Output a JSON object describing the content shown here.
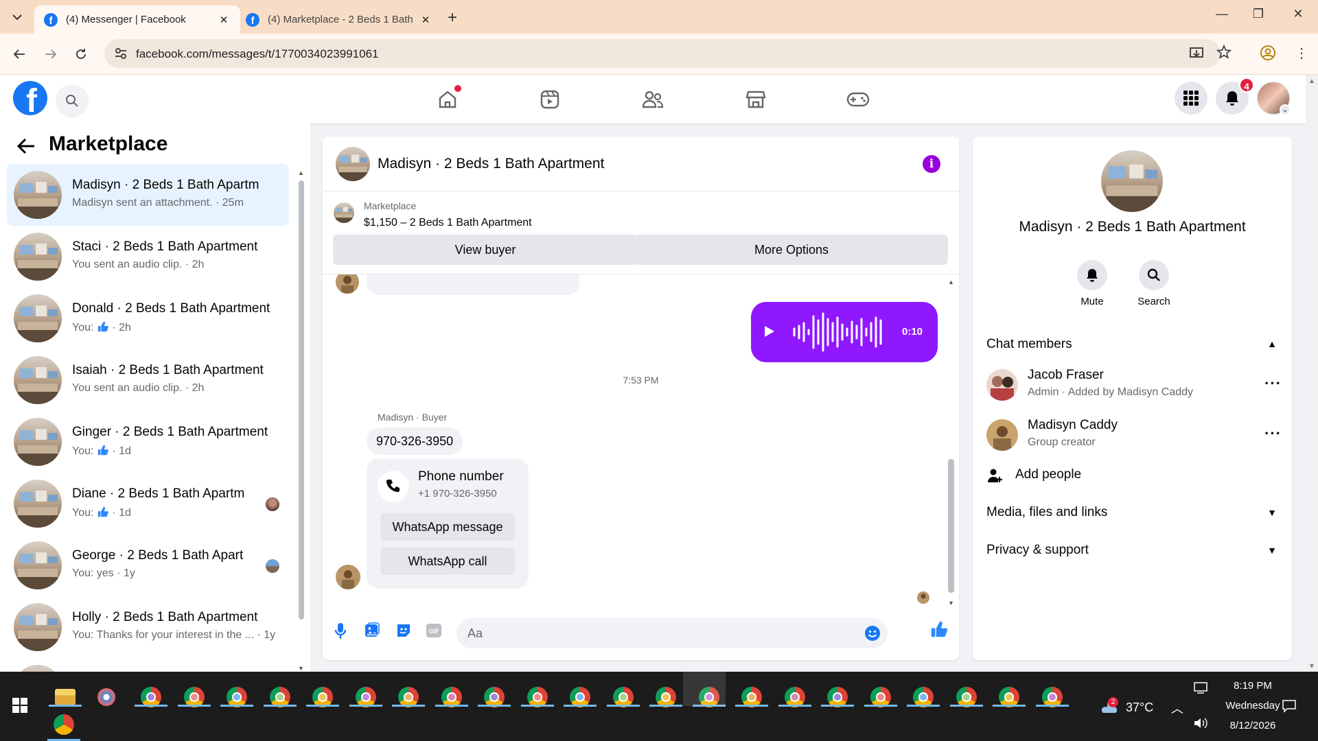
{
  "browser": {
    "tabs": [
      {
        "title": "(4) Messenger | Facebook",
        "active": true
      },
      {
        "title": "(4) Marketplace - 2 Beds 1 Bath",
        "active": false
      }
    ],
    "url": "facebook.com/messages/t/1770034023991061"
  },
  "facebook": {
    "notifications_badge": "4",
    "nav_icons": [
      "home-icon",
      "reels-icon",
      "friends-icon",
      "marketplace-icon",
      "gaming-icon"
    ]
  },
  "sidebar": {
    "title": "Marketplace",
    "conversations": [
      {
        "name": "Madisyn · 2 Beds 1 Bath Apartm",
        "preview": "Madisyn sent an attachment. · 25m",
        "selected": true
      },
      {
        "name": "Staci · 2 Beds 1 Bath Apartment",
        "preview": "You sent an audio clip. · 2h"
      },
      {
        "name": "Donald · 2 Beds 1 Bath Apartment",
        "preview_prefix": "You:",
        "preview": "· 2h",
        "thumbs": true
      },
      {
        "name": "Isaiah · 2 Beds 1 Bath Apartment",
        "preview": "You sent an audio clip. · 2h"
      },
      {
        "name": "Ginger · 2 Beds 1 Bath Apartment",
        "preview_prefix": "You:",
        "preview": "· 1d",
        "thumbs": true
      },
      {
        "name": "Diane · 2 Beds 1 Bath Apartm",
        "preview_prefix": "You:",
        "preview": "· 1d",
        "thumbs": true
      },
      {
        "name": "George · 2 Beds 1 Bath Apart",
        "preview": "You: yes · 1y"
      },
      {
        "name": "Holly · 2 Beds 1 Bath Apartment",
        "preview": "You: Thanks for your interest in the ... · 1y"
      }
    ]
  },
  "chat": {
    "title": "Madisyn · 2 Beds 1 Bath Apartment",
    "marketplace_label": "Marketplace",
    "listing": "$1,150 – 2 Beds 1 Bath Apartment",
    "view_buyer": "View buyer",
    "more_options": "More Options",
    "audio_duration": "0:10",
    "timestamp": "7:53 PM",
    "sender_label": "Madisyn · Buyer",
    "phone_message": "970-326-3950",
    "card_title": "Phone number",
    "card_number": "+1 970-326-3950",
    "whatsapp_message": "WhatsApp message",
    "whatsapp_call": "WhatsApp call",
    "input_placeholder": "Aa"
  },
  "info_panel": {
    "name": "Madisyn · 2 Beds 1 Bath Apartment",
    "mute": "Mute",
    "search": "Search",
    "chat_members": "Chat members",
    "members": [
      {
        "name": "Jacob Fraser",
        "role": "Admin · Added by Madisyn Caddy"
      },
      {
        "name": "Madisyn Caddy",
        "role": "Group creator"
      }
    ],
    "add_people": "Add people",
    "media": "Media, files and links",
    "privacy": "Privacy & support"
  },
  "taskbar": {
    "temperature": "37°C",
    "weather_badge": "2",
    "time": "8:19 PM",
    "day": "Wednesday",
    "date": "8/12/2026"
  },
  "colors": {
    "fb_blue": "#1877f2",
    "purple": "#8f18ff",
    "selected_bg": "#e7f3ff"
  }
}
